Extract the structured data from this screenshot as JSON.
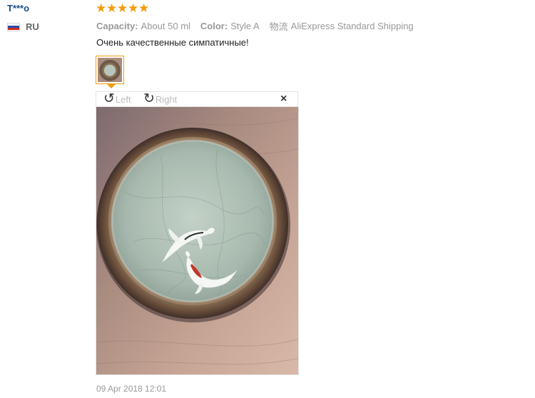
{
  "reviewer": {
    "name": "T***o",
    "country": "RU",
    "flag_colors": [
      "#ffffff",
      "#1f4fb4",
      "#d52b1e"
    ]
  },
  "rating": {
    "stars": 5,
    "max": 5,
    "star_color": "#f29b0d"
  },
  "attributes": [
    {
      "key": "Capacity:",
      "value": "About 50 ml"
    },
    {
      "key": "Color:",
      "value": "Style A"
    }
  ],
  "shipping": {
    "key": "物流",
    "value": "AliExpress Standard Shipping"
  },
  "review_text": "Очень качественные симпатичные!",
  "viewer": {
    "rotate_left_label": "Left",
    "rotate_right_label": "Right",
    "rotate_left_icon": "rotate-left-icon",
    "rotate_right_icon": "rotate-right-icon",
    "close_icon": "close-icon"
  },
  "review_date": "09 Apr 2018 12:01",
  "colors": {
    "accent": "#f29b0d",
    "name": "#1a4b8c",
    "muted": "#999999"
  }
}
